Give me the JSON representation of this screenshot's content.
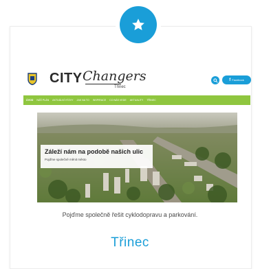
{
  "badge": {
    "icon": "star-icon",
    "color": "#1a9ed8"
  },
  "site": {
    "crest_icon": "city-crest-icon",
    "logo_bold": "CITY",
    "logo_script": "Changers",
    "logo_city": "Třinec",
    "search_icon": "search-icon",
    "facebook_label": "Facebook",
    "facebook_icon": "facebook-icon",
    "nav_items": [
      "Úvod",
      "Náš plán",
      "Aktuální výzvy",
      "Jak na to",
      "Inspirace",
      "Co nás vede",
      "Aktuality",
      "Třinec"
    ],
    "hero_title": "Záleží nám na podobě našich ulic",
    "hero_subtitle": "Pojďme společně měnit město"
  },
  "tagline": "Pojďme společně řešit cyklodopravu a parkování.",
  "city": "Třinec",
  "colors": {
    "accent": "#1a9ed8",
    "nav_green": "#8fc63f"
  }
}
